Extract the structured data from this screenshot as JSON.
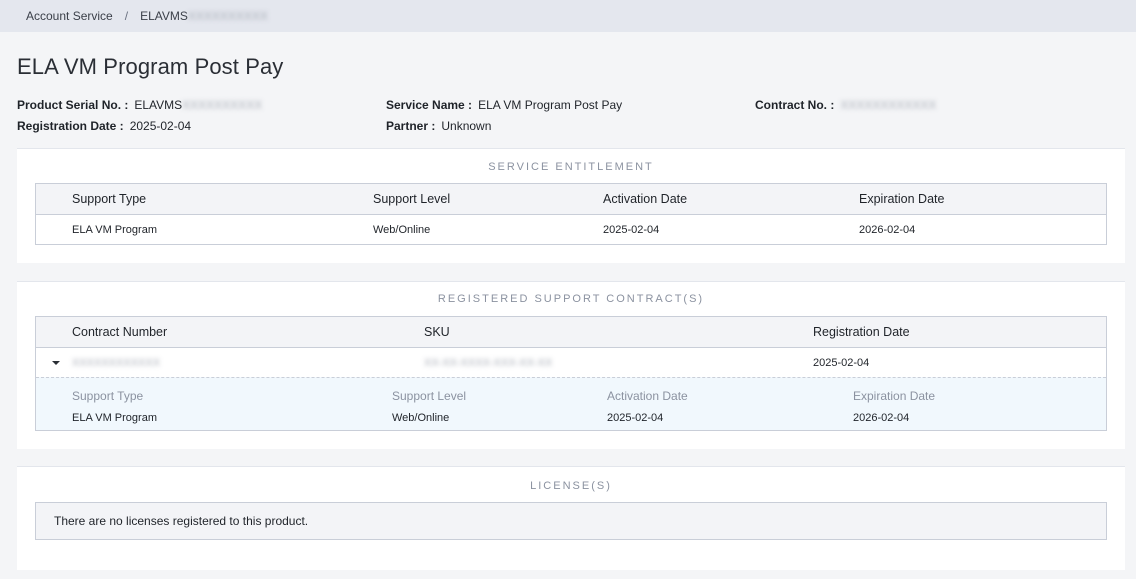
{
  "breadcrumb": {
    "items": [
      "Account Service",
      "ELAVMS"
    ],
    "separator": "/",
    "masked_tail": "XXXXXXXXXX"
  },
  "page": {
    "title": "ELA VM Program Post Pay"
  },
  "meta": {
    "serial_label": "Product Serial No. :",
    "serial_value": "ELAVMS",
    "serial_masked": "XXXXXXXXXX",
    "reg_date_label": "Registration Date :",
    "reg_date_value": "2025-02-04",
    "service_name_label": "Service Name :",
    "service_name_value": "ELA VM Program Post Pay",
    "partner_label": "Partner :",
    "partner_value": "Unknown",
    "contract_label": "Contract No. :",
    "contract_masked": "XXXXXXXXXXXX"
  },
  "entitlement": {
    "title": "SERVICE ENTITLEMENT",
    "headers": [
      "Support Type",
      "Support Level",
      "Activation Date",
      "Expiration Date"
    ],
    "rows": [
      [
        "ELA VM Program",
        "Web/Online",
        "2025-02-04",
        "2026-02-04"
      ]
    ]
  },
  "contracts": {
    "title": "REGISTERED SUPPORT CONTRACT(S)",
    "headers": [
      "Contract Number",
      "SKU",
      "Registration Date"
    ],
    "row": {
      "contract_masked": "XXXXXXXXXXXX",
      "sku_masked": "XX-XX-XXXX-XXX-XX-XX",
      "registration_date": "2025-02-04"
    },
    "detail_headers": [
      "Support Type",
      "Support Level",
      "Activation Date",
      "Expiration Date"
    ],
    "detail_values": [
      "ELA VM Program",
      "Web/Online",
      "2025-02-04",
      "2026-02-04"
    ]
  },
  "licenses": {
    "title": "LICENSE(S)",
    "empty_message": "There are no licenses registered to this product."
  },
  "colors": {
    "breadcrumb_bg": "#e4e7ee",
    "page_bg": "#f4f5f7",
    "card_bg": "#ffffff",
    "border": "#c9ced8",
    "detail_bg": "#f1f8fd",
    "muted_text": "#8b92a0"
  }
}
